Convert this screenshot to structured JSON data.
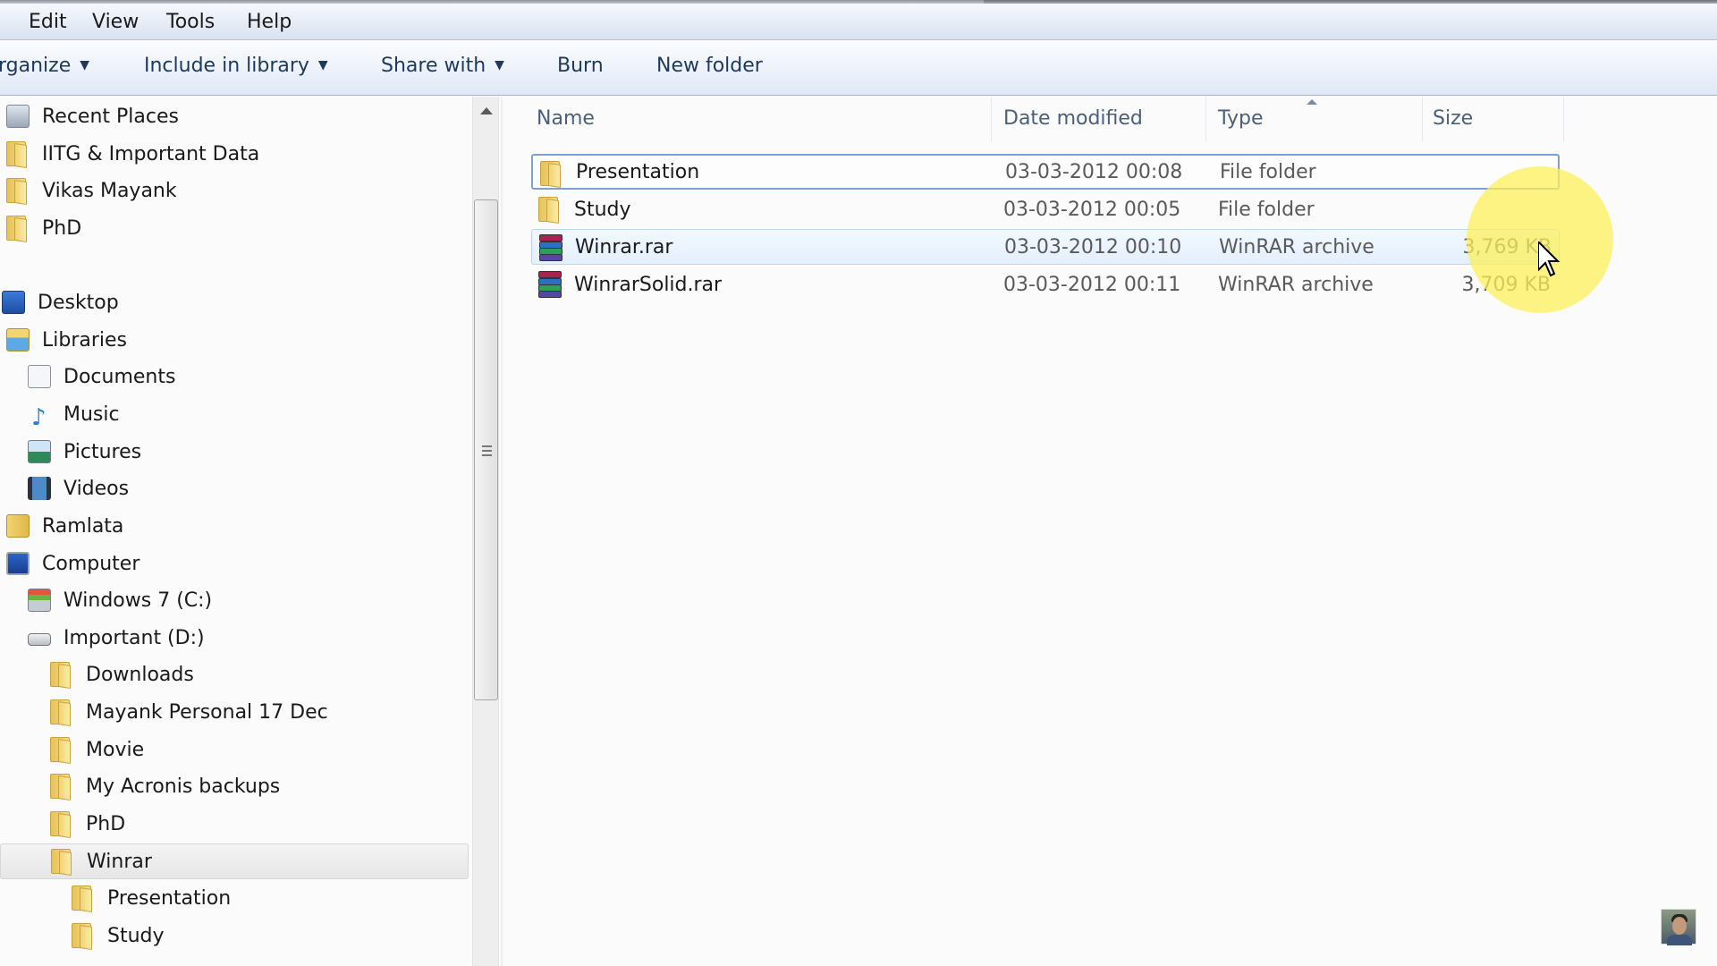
{
  "menu": {
    "items": [
      "Edit",
      "View",
      "Tools",
      "Help"
    ]
  },
  "toolbar": {
    "organize_label": "rganize",
    "include_library_label": "Include in library",
    "share_with_label": "Share with",
    "burn_label": "Burn",
    "new_folder_label": "New folder"
  },
  "nav": {
    "items": [
      {
        "label": "Recent Places",
        "icon": "recent-places-icon"
      },
      {
        "label": "IITG & Important Data",
        "icon": "folder-icon"
      },
      {
        "label": "Vikas Mayank",
        "icon": "folder-icon"
      },
      {
        "label": "PhD",
        "icon": "folder-icon"
      },
      {
        "label": "Desktop",
        "icon": "desktop-icon"
      },
      {
        "label": "Libraries",
        "icon": "libraries-icon"
      },
      {
        "label": "Documents",
        "icon": "documents-icon"
      },
      {
        "label": "Music",
        "icon": "music-icon"
      },
      {
        "label": "Pictures",
        "icon": "pictures-icon"
      },
      {
        "label": "Videos",
        "icon": "videos-icon"
      },
      {
        "label": "Ramlata",
        "icon": "user-folder-icon"
      },
      {
        "label": "Computer",
        "icon": "computer-icon"
      },
      {
        "label": "Windows 7 (C:)",
        "icon": "system-drive-icon"
      },
      {
        "label": "Important (D:)",
        "icon": "drive-icon"
      },
      {
        "label": "Downloads",
        "icon": "folder-icon"
      },
      {
        "label": "Mayank Personal 17 Dec",
        "icon": "folder-icon"
      },
      {
        "label": "Movie",
        "icon": "folder-icon"
      },
      {
        "label": "My Acronis backups",
        "icon": "folder-icon"
      },
      {
        "label": "PhD",
        "icon": "folder-icon"
      },
      {
        "label": "Winrar",
        "icon": "folder-icon",
        "selected": true
      },
      {
        "label": "Presentation",
        "icon": "folder-icon"
      },
      {
        "label": "Study",
        "icon": "folder-icon"
      }
    ]
  },
  "filelist": {
    "columns": {
      "name": "Name",
      "date": "Date modified",
      "type": "Type",
      "size": "Size"
    },
    "sorted_column": "type",
    "rows": [
      {
        "name": "Presentation",
        "date": "03-03-2012 00:08",
        "type": "File folder",
        "size": "",
        "icon": "folder-icon",
        "state": "focused"
      },
      {
        "name": "Study",
        "date": "03-03-2012 00:05",
        "type": "File folder",
        "size": "",
        "icon": "folder-icon",
        "state": ""
      },
      {
        "name": "Winrar.rar",
        "date": "03-03-2012 00:10",
        "type": "WinRAR archive",
        "size": "3,769 KB",
        "icon": "winrar-archive-icon",
        "state": "hover"
      },
      {
        "name": "WinrarSolid.rar",
        "date": "03-03-2012 00:11",
        "type": "WinRAR archive",
        "size": "3,709 KB",
        "icon": "winrar-archive-icon",
        "state": ""
      }
    ]
  },
  "colors": {
    "cursor_highlight": "#fcf05a",
    "focus_border": "#7da2ce",
    "hover_border": "#b8d6fb",
    "toolbar_text": "#1e395b",
    "header_text": "#4c607a"
  }
}
